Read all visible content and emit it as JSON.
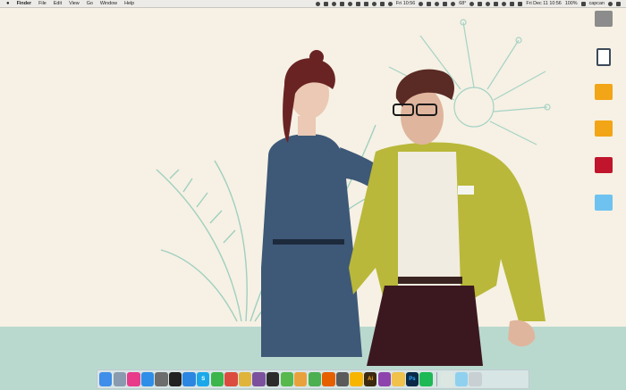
{
  "menubar": {
    "apple": "",
    "app_name": "Finder",
    "menus": [
      "File",
      "Edit",
      "View",
      "Go",
      "Window",
      "Help"
    ],
    "status": {
      "time_1": "Fri 10:56",
      "weather": "68°",
      "clock": "Fri Dec 11 10:56",
      "battery": "100%",
      "user": "capcan"
    }
  },
  "desktop_icons": [
    {
      "icon": "hard-drive-icon",
      "color": "#8c8c8c"
    },
    {
      "icon": "sd-card-icon",
      "color": "#3c4a5a"
    },
    {
      "icon": "external-drive-icon",
      "color": "#f2a516"
    },
    {
      "icon": "external-drive-icon",
      "color": "#f2a516"
    },
    {
      "icon": "app-icon",
      "color": "#c0152c"
    },
    {
      "icon": "folder-icon",
      "color": "#6ec2f0"
    }
  ],
  "dock": {
    "apps": [
      {
        "icon": "finder-icon",
        "color": "#3f8ee9"
      },
      {
        "icon": "launchpad-icon",
        "color": "#8a9bb0"
      },
      {
        "icon": "itunes-icon",
        "color": "#e83b8a"
      },
      {
        "icon": "app-store-icon",
        "color": "#2e8ee8"
      },
      {
        "icon": "system-preferences-icon",
        "color": "#6d6d6d"
      },
      {
        "icon": "terminal-icon",
        "color": "#222222"
      },
      {
        "icon": "safari-icon",
        "color": "#2a86e0"
      },
      {
        "icon": "skype-icon",
        "color": "#1ba8eb"
      },
      {
        "icon": "evernote-icon",
        "color": "#3cb54a"
      },
      {
        "icon": "todoist-icon",
        "color": "#db4c3f"
      },
      {
        "icon": "chrome-icon",
        "color": "#e0b43a"
      },
      {
        "icon": "viber-icon",
        "color": "#7b519d"
      },
      {
        "icon": "plex-icon",
        "color": "#2c2c2c"
      },
      {
        "icon": "maps-icon",
        "color": "#56b84d"
      },
      {
        "icon": "photos-icon",
        "color": "#e9a23b"
      },
      {
        "icon": "leaf-icon",
        "color": "#4caf50"
      },
      {
        "icon": "firefox-icon",
        "color": "#e66000"
      },
      {
        "icon": "opera-icon",
        "color": "#5b5b5b"
      },
      {
        "icon": "sketch-icon",
        "color": "#f7b500"
      },
      {
        "icon": "illustrator-icon",
        "color": "#3b2a10"
      },
      {
        "icon": "podcast-icon",
        "color": "#8e44ad"
      },
      {
        "icon": "code-editor-icon",
        "color": "#f0c14b"
      },
      {
        "icon": "photoshop-icon",
        "color": "#0b2a4a"
      },
      {
        "icon": "spotify-icon",
        "color": "#1db954"
      }
    ],
    "stacks": [
      {
        "icon": "document-stack-icon",
        "color": "#dce7e2"
      },
      {
        "icon": "downloads-folder-icon",
        "color": "#8fd0ef"
      },
      {
        "icon": "trash-icon",
        "color": "#c8d0d4"
      }
    ],
    "app_letters": {
      "skype": "S",
      "illustrator": "Ai",
      "photoshop": "Ps"
    }
  }
}
